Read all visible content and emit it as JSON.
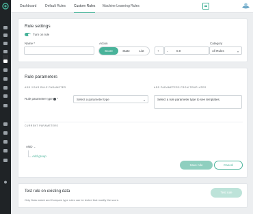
{
  "colors": {
    "accent": "#49b39a",
    "accent_light": "#8fcfbf",
    "sidebar": "#1f2326"
  },
  "sidebar": {
    "icons": [
      "home-icon",
      "list-icon",
      "briefcase-icon",
      "inbox-icon",
      "puzzle-icon",
      "shield-icon",
      "alert-icon",
      "grid-icon",
      "calendar-icon",
      "settings-icon",
      "users-icon",
      "report-icon",
      "document-icon",
      "user-settings-icon",
      "lab-icon"
    ]
  },
  "topbar": {
    "tabs": [
      {
        "label": "Dashboard",
        "active": false
      },
      {
        "label": "Default Rules",
        "active": false
      },
      {
        "label": "Custom Rules",
        "active": true
      },
      {
        "label": "Machine Learning Rules",
        "active": false
      }
    ]
  },
  "rule_settings": {
    "title": "Rule settings",
    "toggle_label": "Turn on rule",
    "name_label": "Name *",
    "name_value": "",
    "action_label": "Action",
    "action_options": [
      "Score",
      "State",
      "List"
    ],
    "action_selected": "Score",
    "operator": "+",
    "operator_arrow": "⌄",
    "amount_value": "0.0",
    "category_label": "Category",
    "category_value": "All Rules"
  },
  "rule_parameters": {
    "title": "Rule parameters",
    "add_label": "ADD YOUR RULE PARAMETER",
    "templates_label": "ADD PARAMETERS FROM TEMPLATES",
    "type_label": "Rule parameter type",
    "type_required": "*",
    "type_placeholder": "Select a parameter type",
    "templates_text": "Select a rule parameter type to see templates.",
    "current_label": "CURRENT PARAMETERS",
    "and_label": "AND",
    "add_group": "Add group",
    "save_label": "Save rule",
    "cancel_label": "Cancel"
  },
  "test_rule": {
    "title": "Test rule on existing data",
    "description": "Only Data match and Compare type rules can be tested that modify the score.",
    "button_label": "Test rule"
  }
}
